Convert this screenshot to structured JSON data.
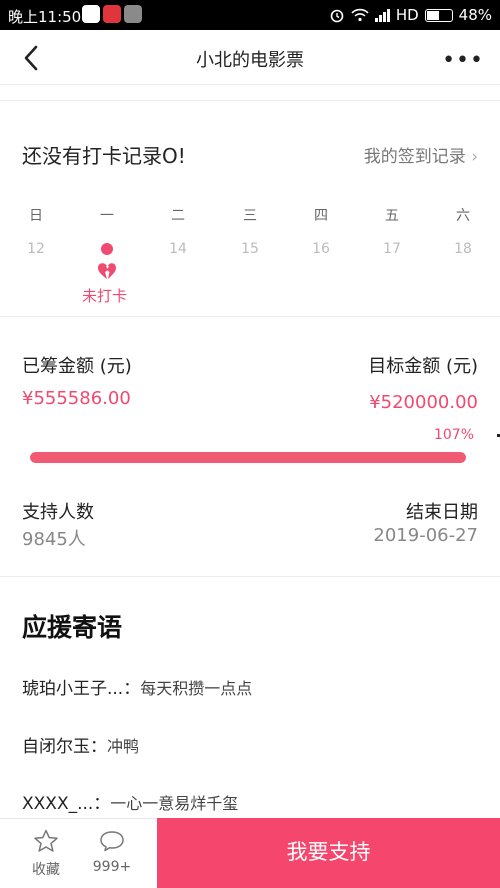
{
  "status_bar": {
    "time": "晚上11:50",
    "network": "HD",
    "battery": "48%",
    "icons": [
      "qq-icon",
      "notification-icon",
      "message-icon",
      "alarm-icon",
      "wifi-icon",
      "signal-icon",
      "battery-icon"
    ]
  },
  "header": {
    "title": "小北的电影票",
    "more": "•••"
  },
  "checkin": {
    "title": "还没有打卡记录O!",
    "record_link": "我的签到记录",
    "weekdays": [
      "日",
      "一",
      "二",
      "三",
      "四",
      "五",
      "六"
    ],
    "dates": [
      "12",
      "",
      "14",
      "15",
      "16",
      "17",
      "18"
    ],
    "missed_label": "未打卡"
  },
  "funding": {
    "raised_label": "已筹金额 (元)",
    "raised_value": "¥555586.00",
    "target_label": "目标金额 (元)",
    "target_value": "¥520000.00",
    "percent_label": "107%",
    "progress_fraction": 1.0,
    "backers_label": "支持人数",
    "backers_value": "9845人",
    "end_label": "结束日期",
    "end_value": "2019-06-27"
  },
  "messages": {
    "title": "应援寄语",
    "items": [
      {
        "user": "琥珀小王子...：",
        "text": "每天积攒一点点"
      },
      {
        "user": "自闭尔玉：",
        "text": "冲鸭"
      },
      {
        "user": "XXXX_...：",
        "text": "一心一意易烊千玺"
      }
    ]
  },
  "bottom_bar": {
    "favorite_label": "收藏",
    "comments_label": "999+",
    "support_label": "我要支持"
  },
  "colors": {
    "accent": "#f5476d",
    "progress": "#f05a73"
  }
}
